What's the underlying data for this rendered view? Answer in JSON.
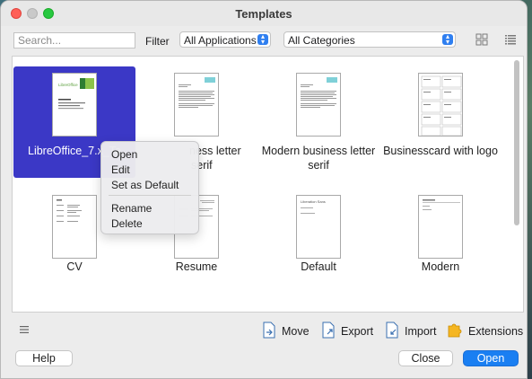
{
  "window": {
    "title": "Templates"
  },
  "toolbar": {
    "search_placeholder": "Search...",
    "filter_label": "Filter",
    "applications_value": "All Applications",
    "categories_value": "All Categories",
    "thumbnail_view_icon": "grid-view-icon",
    "list_view_icon": "list-view-icon"
  },
  "templates": [
    {
      "label": "LibreOffice_7.x_Te",
      "selected": true
    },
    {
      "label_line1": "ness letter",
      "label_line2": "serif"
    },
    {
      "label_line1": "Modern business letter",
      "label_line2": "serif"
    },
    {
      "label": "Businesscard with logo"
    },
    {
      "label": "CV"
    },
    {
      "label": "Resume"
    },
    {
      "label": "Default"
    },
    {
      "label": "Modern"
    }
  ],
  "thumbnail_text": {
    "libreoffice_brand": "LibreOffice",
    "default_thumb_line": "Liberation Sans"
  },
  "context_menu": {
    "items": [
      "Open",
      "Edit",
      "Set as Default",
      "Rename",
      "Delete"
    ]
  },
  "actions": {
    "menu_icon": "hamburger-icon",
    "move": "Move",
    "export": "Export",
    "import": "Import",
    "extensions": "Extensions"
  },
  "buttons": {
    "help": "Help",
    "close": "Close",
    "open": "Open"
  },
  "colors": {
    "selection": "#3b38c6",
    "accent": "#1a7ff2"
  }
}
